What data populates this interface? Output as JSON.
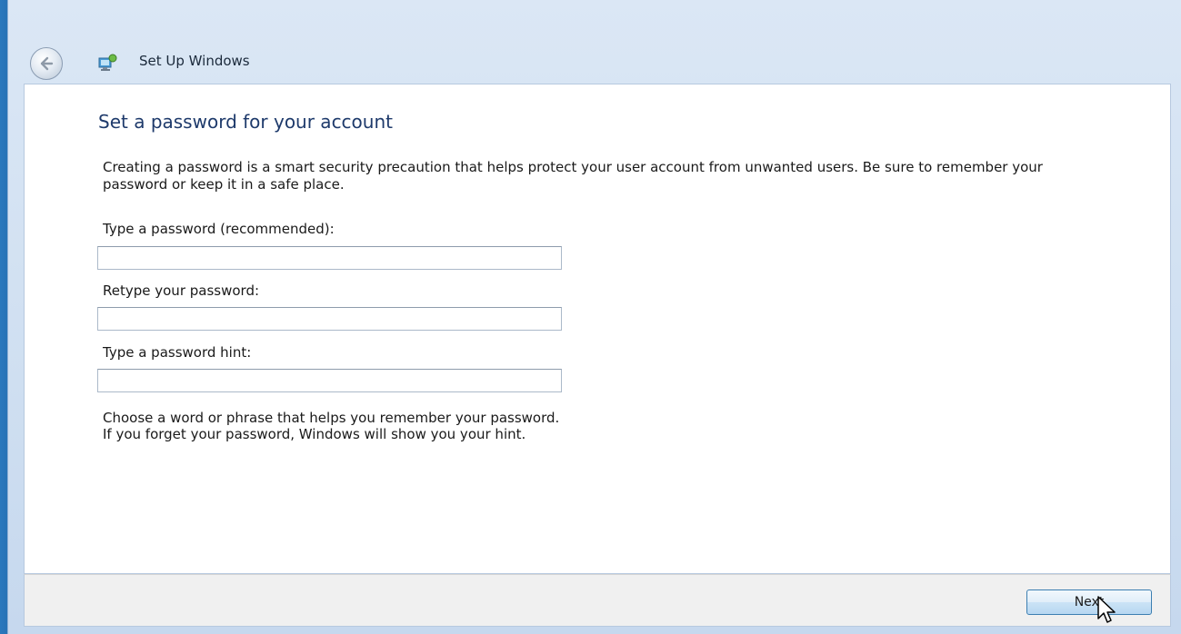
{
  "window": {
    "title": "Set Up Windows",
    "back_icon": "back-arrow-icon",
    "app_icon": "setup-computer-icon"
  },
  "page": {
    "heading": "Set a password for your account",
    "description": "Creating a password is a smart security precaution that helps protect your user account from unwanted users. Be sure to remember your password or keep it in a safe place."
  },
  "form": {
    "password": {
      "label": "Type a password (recommended):",
      "value": ""
    },
    "retype": {
      "label": "Retype your password:",
      "value": ""
    },
    "hint": {
      "label": "Type a password hint:",
      "value": ""
    }
  },
  "hint_text": {
    "line1": "Choose a word or phrase that helps you remember your password.",
    "line2": "If you forget your password, Windows will show you your hint."
  },
  "footer": {
    "next_label": "Next"
  },
  "colors": {
    "heading": "#1e3a6b",
    "desktop": "#1a5b9c",
    "frame": "#d3e2f3",
    "button_border": "#3c7fb1"
  }
}
